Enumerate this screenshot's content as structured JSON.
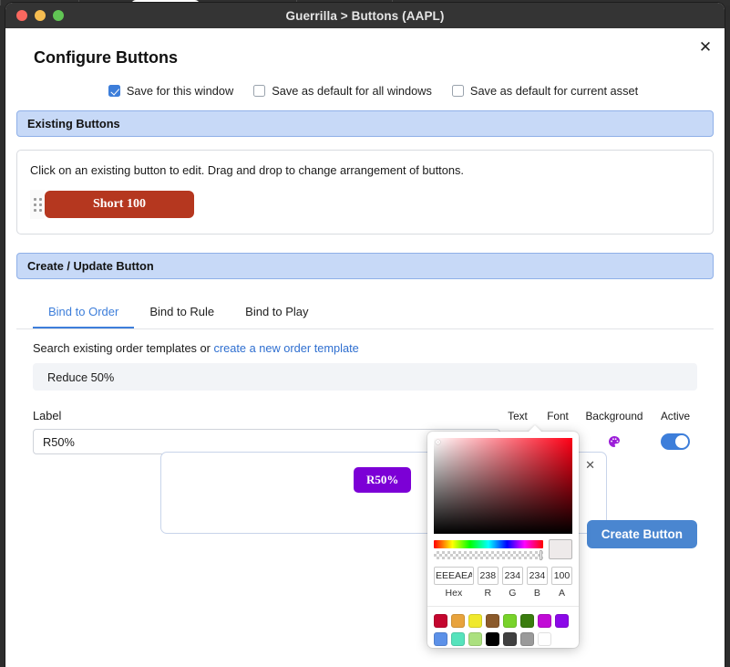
{
  "window": {
    "title": "Guerrilla > Buttons (AAPL)",
    "traffic_lights": [
      "close-red",
      "minimize-yellow",
      "maximize-green"
    ]
  },
  "dialog": {
    "title": "Configure Buttons",
    "close_label": "✕"
  },
  "save_options": [
    {
      "label": "Save for this window",
      "checked": true
    },
    {
      "label": "Save as default for all windows",
      "checked": false
    },
    {
      "label": "Save as default for current asset",
      "checked": false
    }
  ],
  "existing_buttons": {
    "banner": "Existing Buttons",
    "hint": "Click on an existing button to edit. Drag and drop to change arrangement of buttons.",
    "buttons": [
      {
        "label": "Short 100",
        "background": "#B5371F",
        "color": "#FFFFFF"
      }
    ]
  },
  "create_update": {
    "banner": "Create / Update Button",
    "tabs": [
      {
        "label": "Bind to Order",
        "active": true
      },
      {
        "label": "Bind to Rule",
        "active": false
      },
      {
        "label": "Bind to Play",
        "active": false
      }
    ],
    "search_prefix": "Search existing order templates or ",
    "search_link": "create a new order template",
    "result": "Reduce 50%",
    "label_heading": "Label",
    "label_value": "R50%",
    "label_placeholder": "Label",
    "columns": {
      "text": "Text",
      "font": "Font",
      "background": "Background",
      "active": "Active"
    },
    "active_on": true,
    "preview": {
      "label": "R50%",
      "background": "#7C00D6",
      "color": "#FFFFFF"
    },
    "chip_close": "✕",
    "create_button": "Create Button",
    "create_button_color": "#4A86D0"
  },
  "color_picker": {
    "hex_label": "Hex",
    "hex_value": "EEEAEA",
    "channels": [
      {
        "label": "R",
        "value": "238"
      },
      {
        "label": "G",
        "value": "234"
      },
      {
        "label": "B",
        "value": "234"
      },
      {
        "label": "A",
        "value": "100"
      }
    ],
    "current_color": "#EEEAEA",
    "alpha_percent": 100,
    "swatches_row1": [
      "#C4062F",
      "#E8A33D",
      "#F0E92C",
      "#8B5A2B",
      "#78D32A",
      "#3A7C0E",
      "#C10BD6",
      "#8B08E8"
    ],
    "swatches_row2": [
      "#5C91E8",
      "#56E3BC",
      "#ABE07F",
      "#000000",
      "#404040",
      "#9A9A9A",
      "#FFFFFF"
    ]
  }
}
